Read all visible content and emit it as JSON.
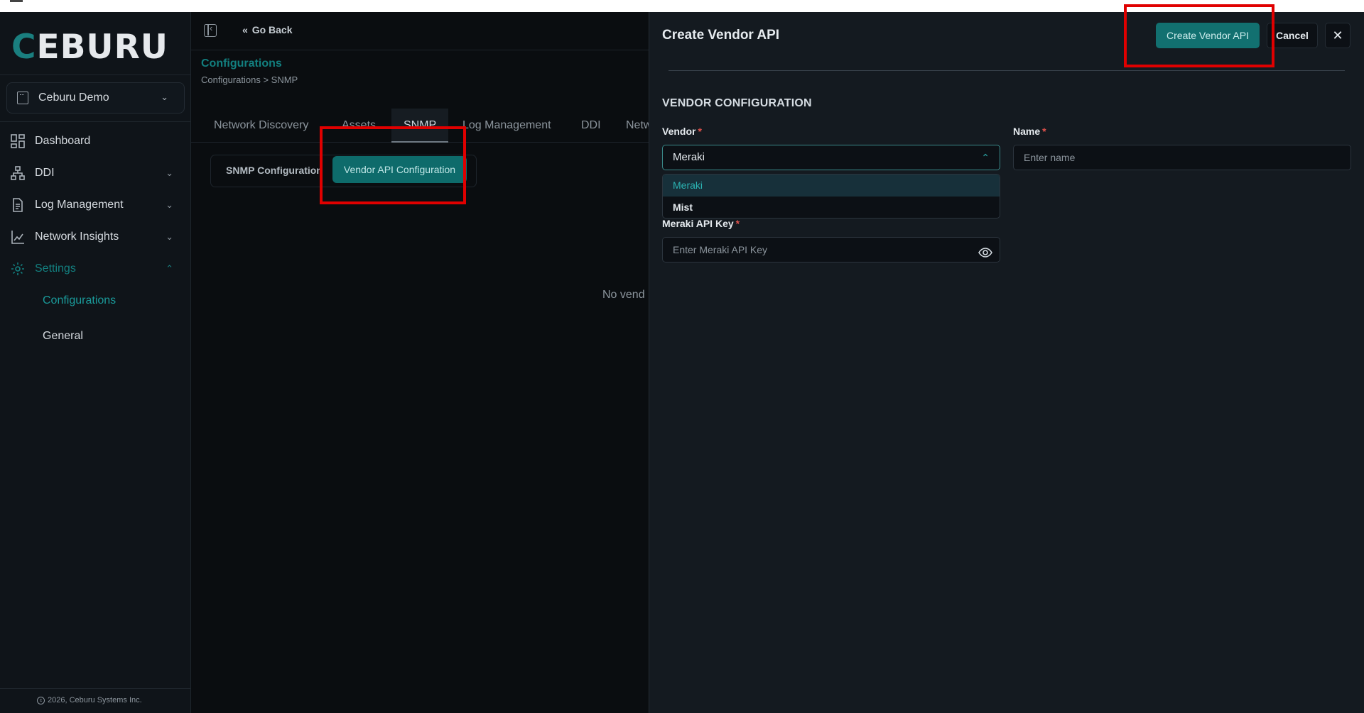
{
  "brand": {
    "logo": "CEBURU"
  },
  "org_selector": {
    "value": "Ceburu Demo"
  },
  "sidebar": {
    "items": [
      {
        "label": "Dashboard",
        "icon": "dashboard-grid-icon"
      },
      {
        "label": "DDI",
        "icon": "network-tree-icon"
      },
      {
        "label": "Log Management",
        "icon": "document-icon"
      },
      {
        "label": "Network Insights",
        "icon": "chart-icon"
      },
      {
        "label": "Settings",
        "icon": "gear-icon",
        "active": true
      }
    ],
    "subitems": [
      {
        "label": "Configurations",
        "active": true
      },
      {
        "label": "General"
      }
    ],
    "copyright": "2026, Ceburu Systems Inc."
  },
  "header": {
    "go_back": "Go Back"
  },
  "page": {
    "title": "Configurations",
    "breadcrumb": "Configurations > SNMP",
    "tabs": [
      "Network Discovery",
      "Assets",
      "SNMP",
      "Log Management",
      "DDI",
      "Netw"
    ],
    "active_tab": "SNMP",
    "subtabs": [
      "SNMP Configuration",
      "Vendor API Configuration"
    ],
    "empty_message": "No vend"
  },
  "drawer": {
    "title": "Create Vendor API",
    "create_label": "Create Vendor API",
    "cancel_label": "Cancel",
    "section_title": "VENDOR CONFIGURATION",
    "vendor_label": "Vendor",
    "vendor_value": "Meraki",
    "vendor_options": [
      "Meraki",
      "Mist"
    ],
    "name_label": "Name",
    "name_placeholder": "Enter name",
    "api_key_label": "Meraki API Key",
    "api_key_placeholder": "Enter Meraki API Key",
    "required_mark": "*"
  },
  "colors": {
    "accent": "#127070",
    "highlight": "#e00000",
    "required": "#e0524c"
  }
}
